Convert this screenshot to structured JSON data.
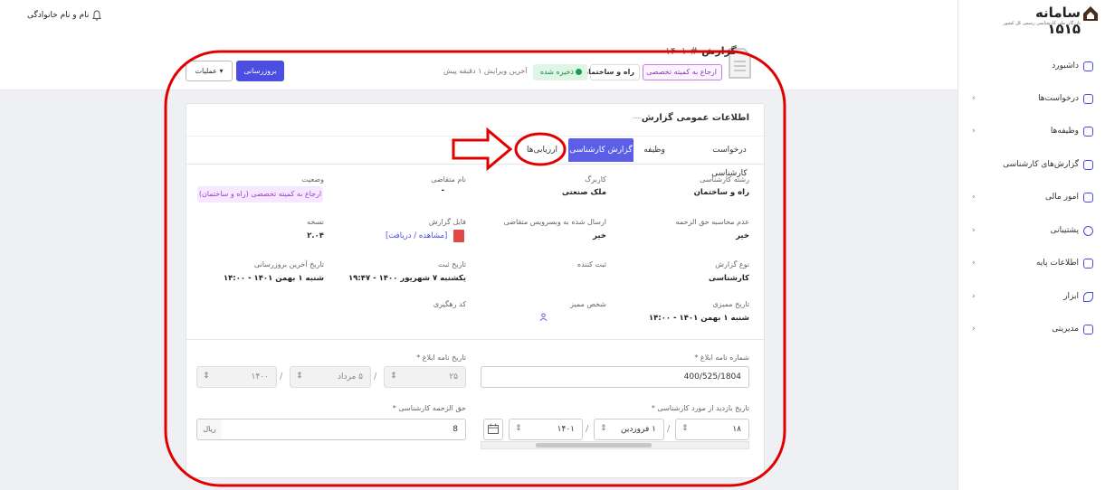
{
  "topbar": {
    "user_name": "نام و نام خانوادگی"
  },
  "header": {
    "report_title": "گزارش",
    "report_number": "# ۱۴۰۱",
    "badge_referral": "ارجاع به کمیته تخصصی",
    "badge_category": "راه و ساختمان",
    "badge_saved": "ذخیره شده",
    "last_edit": "آخرین ویرایش ۱ دقیقه پیش",
    "update_button": "بروزرسانی",
    "operations_button": "عملیات ▾"
  },
  "sidebar": {
    "logo_text": "سامانه ۱۵۱۵",
    "logo_sub": "بازرگان ملی کارشناسی رسمی کل کشور",
    "items": [
      {
        "label": "داشبورد",
        "has_chevron": false
      },
      {
        "label": "درخواست‌ها",
        "has_chevron": true
      },
      {
        "label": "وظیفه‌ها",
        "has_chevron": true
      },
      {
        "label": "گزارش‌های کارشناسی",
        "has_chevron": false
      },
      {
        "label": "امور مالی",
        "has_chevron": true
      },
      {
        "label": "پشتیبانی",
        "has_chevron": true
      },
      {
        "label": "اطلاعات پایه",
        "has_chevron": true
      },
      {
        "label": "ابزار",
        "has_chevron": true
      },
      {
        "label": "مدیریتی",
        "has_chevron": true
      }
    ]
  },
  "card": {
    "title": "اطلاعات عمومی گزارش",
    "tabs": [
      "درخواست کارشناسی",
      "وظیفه",
      "گزارش کارشناسی",
      "ارزیابی‌ها"
    ],
    "active_tab": "گزارش کارشناسی",
    "fields": {
      "field_expert_label": "رشته کارشناسی",
      "field_expert_value": "راه و ساختمان",
      "usage_label": "کاربرگ",
      "usage_value": "ملک صنعتی",
      "applicant_label": "نام متقاضی",
      "applicant_value": "-",
      "status_label": "وضعیت",
      "status_value": "ارجاع به کمیته تخصصی (راه و ساختمان)",
      "fee_calc_label": "عدم محاسبه حق الزحمه",
      "fee_calc_value": "خیر",
      "webservice_label": "ارسال شده به وبسرویس متقاضی",
      "webservice_value": "خیر",
      "report_file_label": "فایل گزارش",
      "report_file_link": "[مشاهده / دریافت]",
      "version_label": "نسخه",
      "version_value": "۲.۰۴",
      "report_type_label": "نوع گزارش",
      "report_type_value": "کارشناسی",
      "registrar_label": "ثبت کننده",
      "register_date_label": "تاریخ ثبت",
      "register_date_value": "یکشنبه ۷ شهریور ۱۴۰۰ - ۱۹:۴۷",
      "last_update_label": "تاریخ آخرین بروزرسانی",
      "last_update_value": "شنبه ۱ بهمن ۱۴۰۱ - ۱۴:۰۰",
      "audit_date_label": "تاریخ ممیزی",
      "audit_date_value": "شنبه ۱ بهمن ۱۴۰۱ - ۱۴:۰۰",
      "auditor_label": "شخص ممیز",
      "tracking_label": "کد رهگیری"
    },
    "form": {
      "notice_number_label": "شماره نامه ابلاغ *",
      "notice_number_value": "400/525/1804",
      "notice_date_label": "تاریخ نامه ابلاغ *",
      "notice_day": "۲۵",
      "notice_month": "۵ مرداد",
      "notice_year": "۱۴۰۰",
      "visit_date_label": "تاریخ بازدید از مورد کارشناسی *",
      "visit_day": "۱۸",
      "visit_month": "۱ فروردین",
      "visit_year": "۱۴۰۱",
      "fee_label": "حق الزحمه کارشناسی *",
      "fee_value": "8",
      "fee_unit": "ریال"
    }
  },
  "annotation": {
    "color": "#e00000"
  }
}
